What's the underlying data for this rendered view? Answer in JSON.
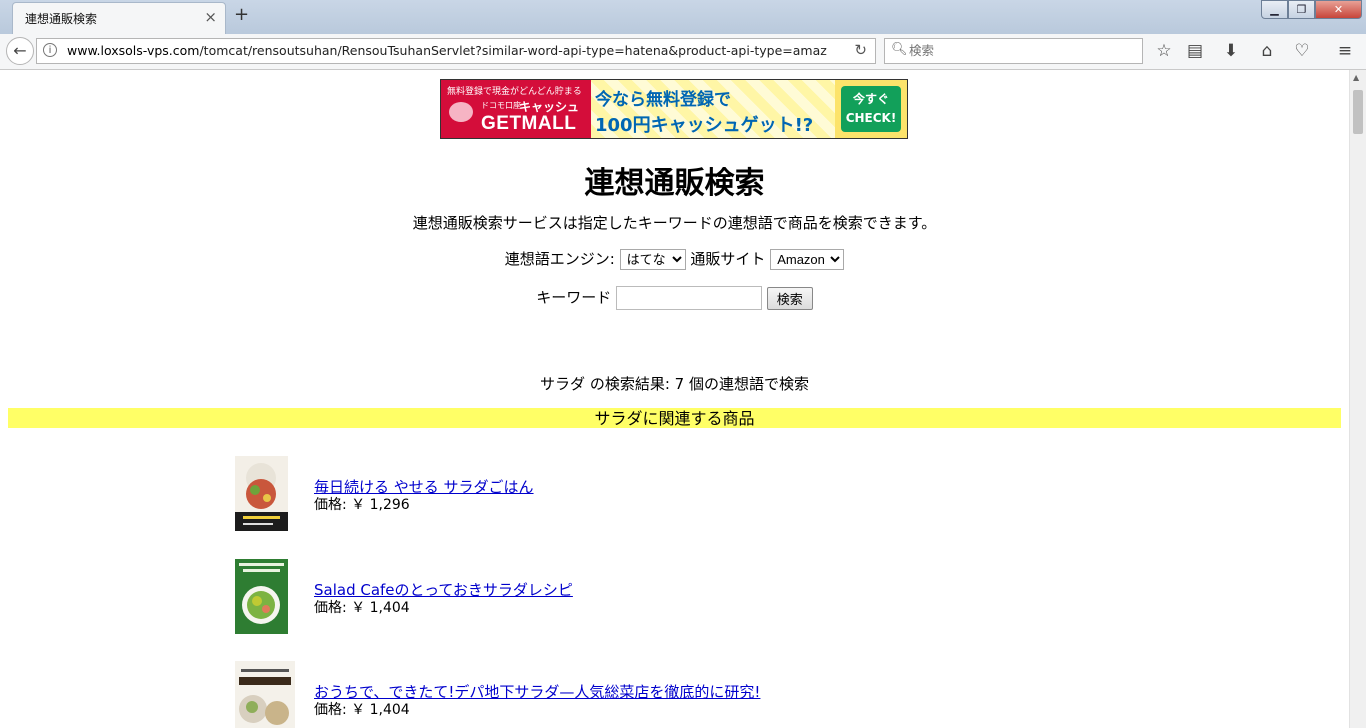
{
  "browser": {
    "tab_title": "連想通販検索",
    "tab_close": "×",
    "new_tab": "+",
    "url_host": "www.loxsols-vps.com",
    "url_path": "/tomcat/rensoutsuhan/RensouTsuhanServlet?similar-word-api-type=hatena&product-api-type=amazon&s",
    "search_placeholder": "検索",
    "icons": [
      "back-arrow-icon",
      "info-icon",
      "reload-icon",
      "search-icon",
      "bookmark-star-icon",
      "reader-list-icon",
      "download-icon",
      "home-icon",
      "pocket-icon",
      "menu-icon"
    ]
  },
  "banner": {
    "small_text": "無料登録で現金がどんどん貯まる",
    "docomo": "ドコモ口座",
    "cash": "キャッシュ",
    "brand": "GETMALL",
    "headline_1": "今なら無料登録で",
    "headline_2": "100円キャッシュゲット!?",
    "cta_1": "今すぐ",
    "cta_2": "CHECK!",
    "colors": {
      "brand_red": "#d40d3a",
      "cta_green": "#12a05a",
      "text_blue": "#0066b3"
    }
  },
  "page": {
    "title": "連想通販検索",
    "description": "連想通販検索サービスは指定したキーワードの連想語で商品を検索できます。",
    "engine_label": "連想語エンジン:",
    "engine_selected": "はてな",
    "site_label": "通販サイト",
    "site_selected": "Amazon",
    "keyword_label": "キーワード",
    "keyword_value": "",
    "search_button": "検索",
    "result_summary": "サラダ の検索結果: 7 個の連想語で検索",
    "related_header": "サラダに関連する商品",
    "related_bar_color": "#ffff66"
  },
  "products": [
    {
      "title": "毎日続ける やせる サラダごはん",
      "price": "価格: ￥ 1,296"
    },
    {
      "title": "Salad Cafeのとっておきサラダレシピ",
      "price": "価格: ￥ 1,404"
    },
    {
      "title": "おうちで、できたて!デパ地下サラダ—人気総菜店を徹底的に研究!",
      "price": "価格: ￥ 1,404"
    }
  ]
}
